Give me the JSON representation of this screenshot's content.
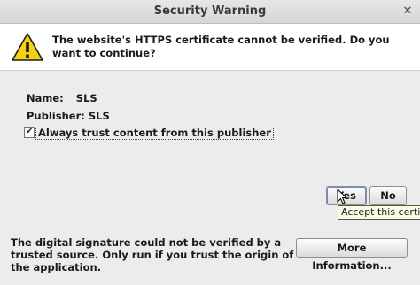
{
  "window": {
    "title": "Security Warning",
    "close_icon": "close-icon"
  },
  "header": {
    "icon": "warning-triangle-icon",
    "message": "The website's HTTPS certificate cannot be verified. Do you want to continue?"
  },
  "details": {
    "name_label": "Name:",
    "name_value": "SLS",
    "publisher_label": "Publisher:",
    "publisher_value": "SLS"
  },
  "trust_option": {
    "label": "Always trust content from this publisher",
    "checked": true
  },
  "buttons": {
    "yes": "Yes",
    "no": "No",
    "more_info": "More Information..."
  },
  "tooltip": {
    "text": "Accept this certificate"
  },
  "footer": {
    "message": "The digital signature could not be verified by a trusted source. Only run if you trust the origin of the application."
  }
}
